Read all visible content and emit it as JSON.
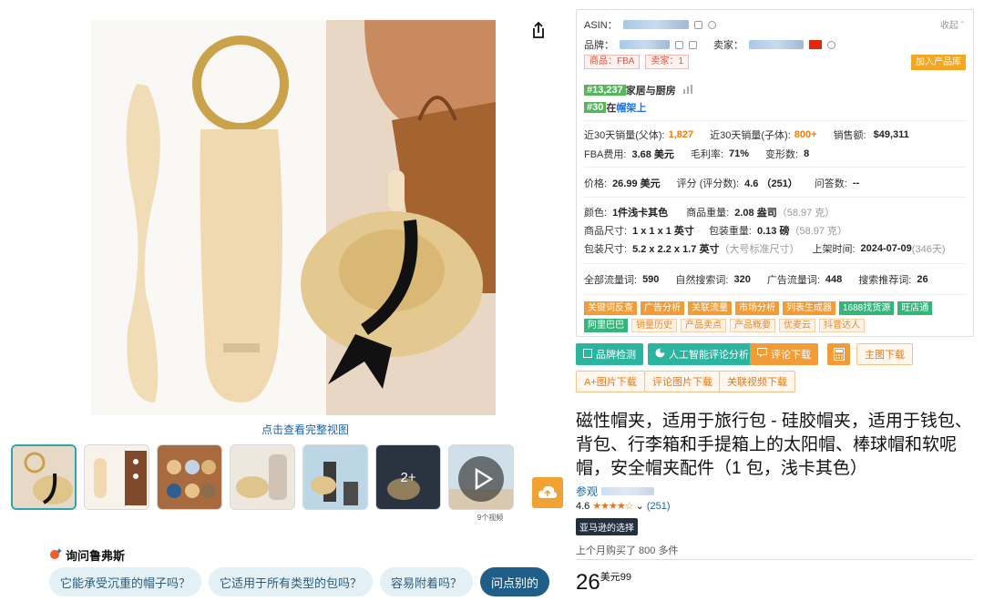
{
  "gallery": {
    "view_full_label": "点击查看完整视图",
    "video_count_label": "9个视频",
    "more_thumbs_label": "2+"
  },
  "ask": {
    "title": "询问鲁弗斯",
    "chips": [
      "它能承受沉重的帽子吗？",
      "它适用于所有类型的包吗？",
      "容易附着吗？",
      "问点别的"
    ]
  },
  "plugin": {
    "asin_label": "ASIN：",
    "collapse_label": "收起",
    "brand_label": "品牌：",
    "seller_label": "卖家：",
    "tag_goods": "商品：FBA",
    "tag_seller": "卖家：1",
    "add_library_label": "加入产品库",
    "rank1_num": "#13,237",
    "rank1_cat": "家居与厨房",
    "rank2_num": "#30",
    "rank2_prefix": "在",
    "rank2_cat": "帽架上",
    "stats": {
      "sales30_parent_label": "近30天销量(父体):",
      "sales30_parent": "1,827",
      "sales30_child_label": "近30天销量(子体):",
      "sales30_child": "800+",
      "revenue_label": "销售额:",
      "revenue": "$49,311",
      "fba_fee_label": "FBA费用:",
      "fba_fee": "3.68 美元",
      "margin_label": "毛利率:",
      "margin": "71%",
      "variants_label": "变形数:",
      "variants": "8",
      "price_label": "价格:",
      "price": "26.99 美元",
      "rating_label": "评分 (评分数):",
      "rating": "4.6 （251）",
      "qa_label": "问答数:",
      "qa": "--",
      "color_label": "颜色:",
      "color": "1件浅卡其色",
      "weight_label": "商品重量:",
      "weight": "2.08 盎司",
      "weight_g": "（58.97 克）",
      "size_label": "商品尺寸:",
      "size": "1 x 1 x 1 英寸",
      "pkg_weight_label": "包装重量:",
      "pkg_weight": "0.13 磅",
      "pkg_weight_g": "（58.97 克）",
      "pkg_size_label": "包装尺寸:",
      "pkg_size": "5.2 x 2.2 x 1.7 英寸",
      "pkg_size_note": "（大号标准尺寸）",
      "listed_label": "上架时间:",
      "listed": "2024-07-09",
      "listed_days": "(346天)",
      "traffic_all_label": "全部流量词:",
      "traffic_all": "590",
      "organic_label": "自然搜索词:",
      "organic": "320",
      "ads_label": "广告流量词:",
      "ads": "448",
      "recommend_label": "搜索推荐词:",
      "recommend": "26"
    },
    "tools_row1": [
      "关键词反查",
      "广告分析",
      "关联流量",
      "市场分析",
      "列表生成器",
      "1688找货源",
      "旺店通"
    ],
    "tools_row2_green": "阿里巴巴",
    "tools_row2": [
      "销量历史",
      "产品卖点",
      "产品概要",
      "优麦云",
      "抖音达人"
    ]
  },
  "actions": {
    "brand_check": "品牌检测",
    "ai_review": "人工智能评论分析",
    "review_download": "评论下载",
    "main_image_download": "主图下载",
    "aplus_download": "A+图片下载",
    "review_image_download": "评论图片下载",
    "related_video_download": "关联视频下载"
  },
  "product": {
    "title": "磁性帽夹，适用于旅行包 - 硅胶帽夹，适用于钱包、背包、行李箱和手提箱上的太阳帽、棒球帽和软呢帽，安全帽夹配件（1 包，浅卡其色）",
    "brand_prefix": "参观",
    "rating": "4.6",
    "stars": "★★★★☆",
    "review_count": "(251)",
    "choice_badge": "亚马逊的选择",
    "bought": "上个月购买了 800 多件",
    "price_whole": "26",
    "price_symbol": "美元",
    "price_fraction": "99"
  },
  "colors": {
    "accent_orange": "#f29c38",
    "accent_green": "#2bb5a0",
    "link_blue": "#2162a1",
    "rating_orange": "#de7921"
  }
}
